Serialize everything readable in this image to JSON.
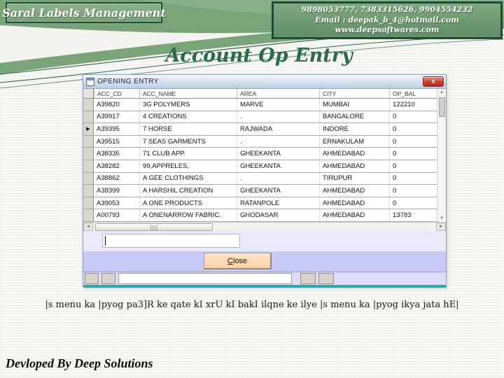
{
  "header": {
    "brand": "Saral Labels Management",
    "contact": {
      "phones": "9898053777, 7383315626, 9904554232",
      "email": "Email : deepak_b_4@hotmail.com",
      "website": "www.deepsoftwares.com"
    }
  },
  "page_title": "Account Op Entry",
  "window": {
    "title": "OPENING ENTRY",
    "columns": [
      "ACC_CD",
      "ACC_NAME",
      "AREA",
      "CITY",
      "OP_BAL"
    ],
    "selected_row_index": 2,
    "rows": [
      {
        "acc_cd": "A39820",
        "acc_name": "3G POLYMERS",
        "area": "MARVE",
        "city": "MUMBAI",
        "op_bal": "122210"
      },
      {
        "acc_cd": "A39917",
        "acc_name": "4 CREATIONS",
        "area": ".",
        "city": "BANGALORE",
        "op_bal": "0"
      },
      {
        "acc_cd": "A39395",
        "acc_name": "7 HORSE",
        "area": "RAJWADA",
        "city": "INDORE",
        "op_bal": "0"
      },
      {
        "acc_cd": "A39515",
        "acc_name": "7 SEAS GARMENTS",
        "area": ".",
        "city": "ERNAKULAM",
        "op_bal": "0"
      },
      {
        "acc_cd": "A38335",
        "acc_name": "71 CLUB APP.",
        "area": "GHEEKANTA",
        "city": "AHMEDABAD",
        "op_bal": "0"
      },
      {
        "acc_cd": "A38282",
        "acc_name": "99,APPRELES,",
        "area": "GHEEKANTA",
        "city": "AHMEDABAD",
        "op_bal": "0"
      },
      {
        "acc_cd": "A38862",
        "acc_name": "A GEE CLOTHINGS",
        "area": ".",
        "city": "TIRUPUR",
        "op_bal": "0"
      },
      {
        "acc_cd": "A38399",
        "acc_name": "A HARSHIL CREATION",
        "area": "GHEEKANTA",
        "city": "AHMEDABAD",
        "op_bal": "0"
      },
      {
        "acc_cd": "A39053",
        "acc_name": "A ONE PRODUCTS",
        "area": "RATANPOLE",
        "city": "AHMEDABAD",
        "op_bal": "0"
      },
      {
        "acc_cd": "A00793",
        "acc_name": "A ONENARROW FABRIC.",
        "area": "GHODASAR",
        "city": "AHMEDABAD",
        "op_bal": "13783"
      }
    ],
    "search_value": "",
    "close_button_label": "Close"
  },
  "icons": {
    "close": "x",
    "row_selector": "▶",
    "scroll_up": "▲",
    "scroll_down": "▼",
    "scroll_left": "◄",
    "scroll_right": "►"
  },
  "caption": "|s menu ka |pyog pa3]R ke qate kI xrU kI bakI ilqne ke ilye |s menu ka |pyog ikya jata hE|",
  "footer": "Devloped By Deep Solutions",
  "colors": {
    "band_green": "#7aa37a",
    "dark_green_border": "#1a4d33",
    "title_green": "#2c6b4a",
    "teal_line": "#2fa8a8",
    "close_peach": "#f9d0a4",
    "lavender_strip": "#c9c9f6",
    "close_x_red": "#c43a2c"
  }
}
